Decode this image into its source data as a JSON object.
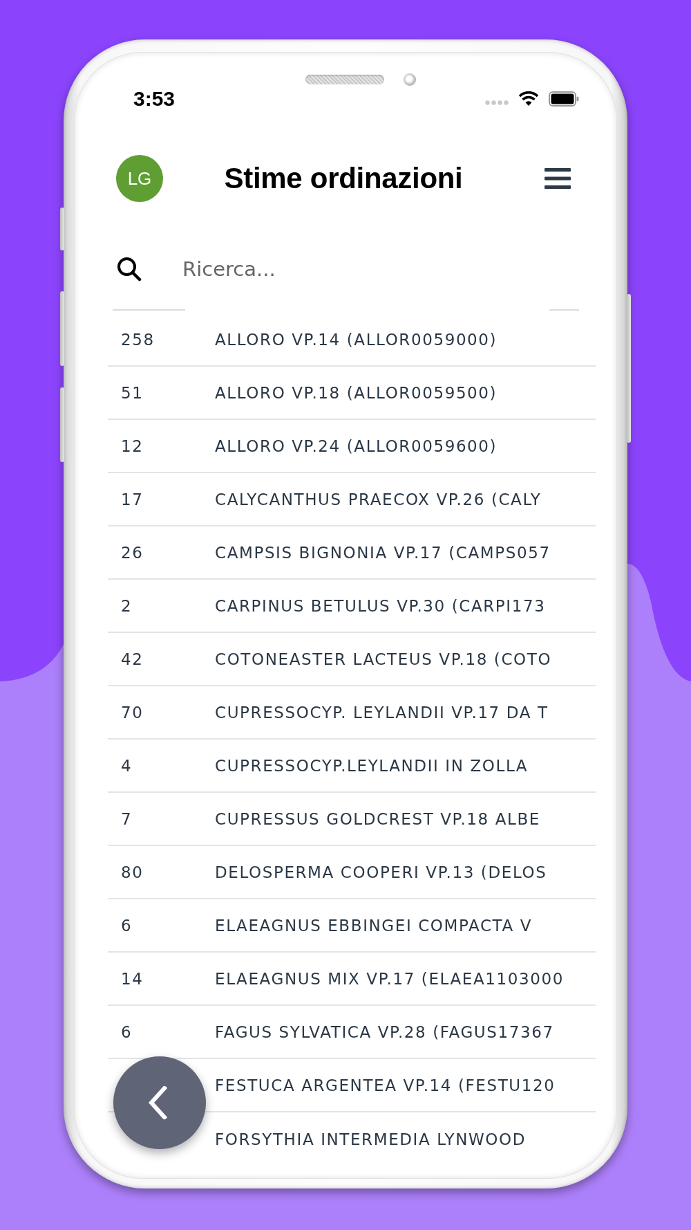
{
  "status_bar": {
    "time": "3:53"
  },
  "header": {
    "avatar_initials": "LG",
    "title": "Stime ordinazioni"
  },
  "search": {
    "placeholder": "Ricerca..."
  },
  "list": {
    "rows": [
      {
        "quantity": "258",
        "name": "ALLORO VP.14 (ALLOR0059000)"
      },
      {
        "quantity": "51",
        "name": "ALLORO VP.18 (ALLOR0059500)"
      },
      {
        "quantity": "12",
        "name": "ALLORO VP.24 (ALLOR0059600)"
      },
      {
        "quantity": "17",
        "name": "CALYCANTHUS PRAECOX VP.26 (CALY"
      },
      {
        "quantity": "26",
        "name": "CAMPSIS BIGNONIA VP.17 (CAMPS057"
      },
      {
        "quantity": "2",
        "name": "CARPINUS BETULUS VP.30 (CARPI173"
      },
      {
        "quantity": "42",
        "name": "COTONEASTER LACTEUS VP.18 (COTO"
      },
      {
        "quantity": "70",
        "name": "CUPRESSOCYP. LEYLANDII VP.17 DA T"
      },
      {
        "quantity": "4",
        "name": "CUPRESSOCYP.LEYLANDII IN ZOLLA"
      },
      {
        "quantity": "7",
        "name": "CUPRESSUS GOLDCREST VP.18 ALBE"
      },
      {
        "quantity": "80",
        "name": "DELOSPERMA COOPERI VP.13 (DELOS"
      },
      {
        "quantity": "6",
        "name": "ELAEAGNUS EBBINGEI COMPACTA V"
      },
      {
        "quantity": "14",
        "name": "ELAEAGNUS MIX VP.17 (ELAEA1103000"
      },
      {
        "quantity": "6",
        "name": "FAGUS SYLVATICA VP.28 (FAGUS17367"
      },
      {
        "name": "FESTUCA ARGENTEA VP.14 (FESTU120"
      },
      {
        "name": "FORSYTHIA INTERMEDIA LYNWOOD"
      }
    ]
  }
}
